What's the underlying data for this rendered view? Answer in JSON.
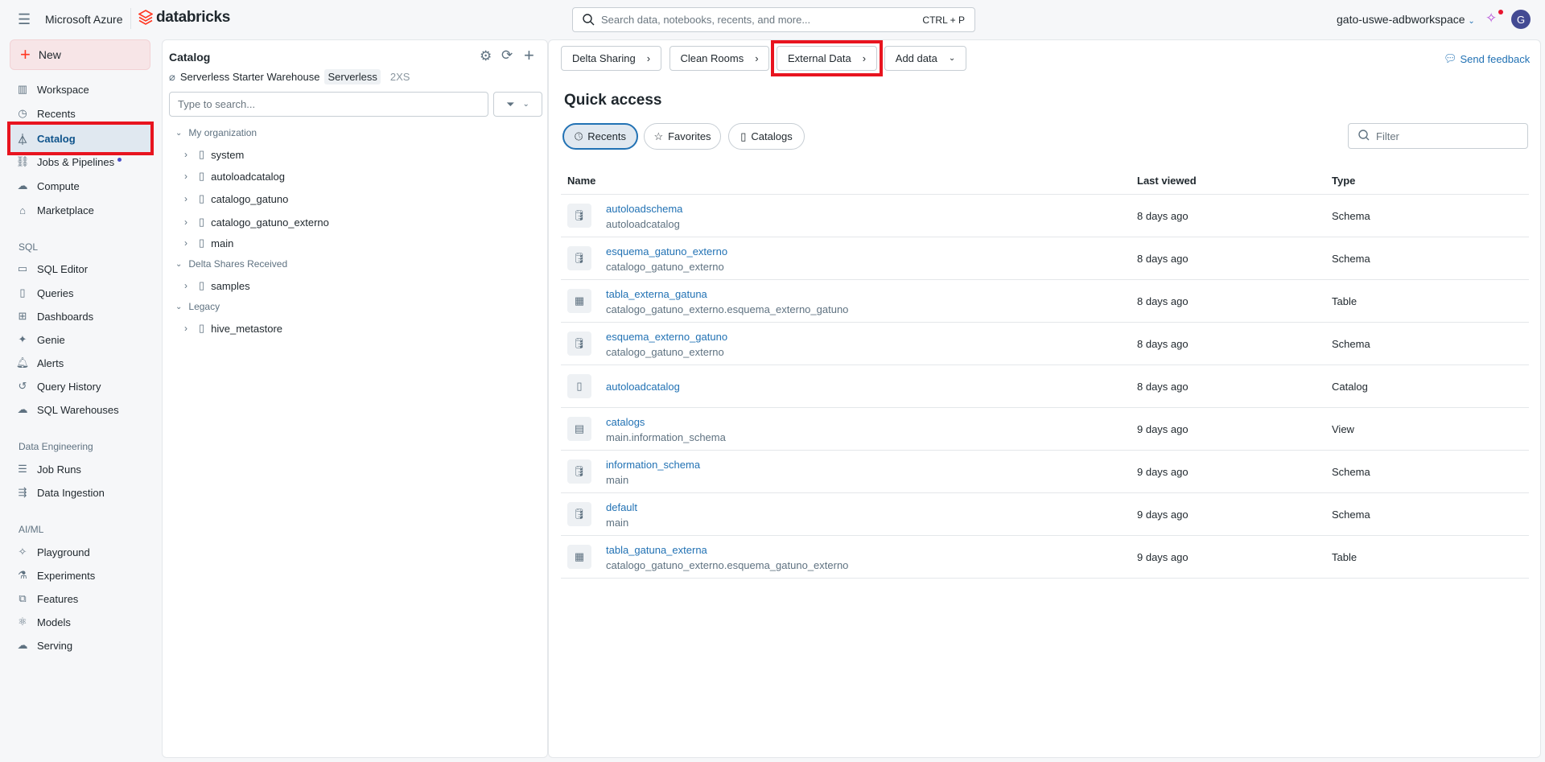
{
  "topbar": {
    "brand": "Microsoft Azure",
    "logo": "databricks",
    "search_placeholder": "Search data, notebooks, recents, and more...",
    "shortcut": "CTRL + P",
    "workspace": "gato-uswe-adbworkspace",
    "avatar": "G"
  },
  "sidebar": {
    "new_label": "New",
    "items": [
      {
        "label": "Workspace",
        "icon": "workspace-icon"
      },
      {
        "label": "Recents",
        "icon": "clock-icon"
      },
      {
        "label": "Catalog",
        "icon": "catalog-icon"
      },
      {
        "label": "Jobs & Pipelines",
        "icon": "jobs-icon"
      },
      {
        "label": "Compute",
        "icon": "cloud-icon"
      },
      {
        "label": "Marketplace",
        "icon": "store-icon"
      }
    ],
    "sql_label": "SQL",
    "sql_items": [
      {
        "label": "SQL Editor"
      },
      {
        "label": "Queries"
      },
      {
        "label": "Dashboards"
      },
      {
        "label": "Genie"
      },
      {
        "label": "Alerts"
      },
      {
        "label": "Query History"
      },
      {
        "label": "SQL Warehouses"
      }
    ],
    "de_label": "Data Engineering",
    "de_items": [
      {
        "label": "Job Runs"
      },
      {
        "label": "Data Ingestion"
      }
    ],
    "ai_label": "AI/ML",
    "ai_items": [
      {
        "label": "Playground"
      },
      {
        "label": "Experiments"
      },
      {
        "label": "Features"
      },
      {
        "label": "Models"
      },
      {
        "label": "Serving"
      }
    ]
  },
  "catalog": {
    "title": "Catalog",
    "warehouse": "Serverless Starter Warehouse",
    "warehouse_type": "Serverless",
    "warehouse_size": "2XS",
    "search_placeholder": "Type to search...",
    "my_org": "My organization",
    "org_items": [
      "system",
      "autoloadcatalog",
      "catalogo_gatuno",
      "catalogo_gatuno_externo",
      "main"
    ],
    "delta_shares": "Delta Shares Received",
    "share_items": [
      "samples"
    ],
    "legacy": "Legacy",
    "legacy_items": [
      "hive_metastore"
    ]
  },
  "main": {
    "buttons": {
      "delta_sharing": "Delta Sharing",
      "clean_rooms": "Clean Rooms",
      "external_data": "External Data",
      "add_data": "Add data"
    },
    "send_feedback": "Send feedback",
    "title": "Quick access",
    "tabs": {
      "recents": "Recents",
      "favorites": "Favorites",
      "catalogs": "Catalogs"
    },
    "filter_placeholder": "Filter",
    "columns": {
      "name": "Name",
      "last_viewed": "Last viewed",
      "type": "Type"
    },
    "rows": [
      {
        "name": "autoloadschema",
        "sub": "autoloadcatalog",
        "last": "8 days ago",
        "type": "Schema"
      },
      {
        "name": "esquema_gatuno_externo",
        "sub": "catalogo_gatuno_externo",
        "last": "8 days ago",
        "type": "Schema"
      },
      {
        "name": "tabla_externa_gatuna",
        "sub": "catalogo_gatuno_externo.esquema_externo_gatuno",
        "last": "8 days ago",
        "type": "Table"
      },
      {
        "name": "esquema_externo_gatuno",
        "sub": "catalogo_gatuno_externo",
        "last": "8 days ago",
        "type": "Schema"
      },
      {
        "name": "autoloadcatalog",
        "sub": "",
        "last": "8 days ago",
        "type": "Catalog"
      },
      {
        "name": "catalogs",
        "sub": "main.information_schema",
        "last": "9 days ago",
        "type": "View"
      },
      {
        "name": "information_schema",
        "sub": "main",
        "last": "9 days ago",
        "type": "Schema"
      },
      {
        "name": "default",
        "sub": "main",
        "last": "9 days ago",
        "type": "Schema"
      },
      {
        "name": "tabla_gatuna_externa",
        "sub": "catalogo_gatuno_externo.esquema_gatuno_externo",
        "last": "9 days ago",
        "type": "Table"
      }
    ]
  }
}
